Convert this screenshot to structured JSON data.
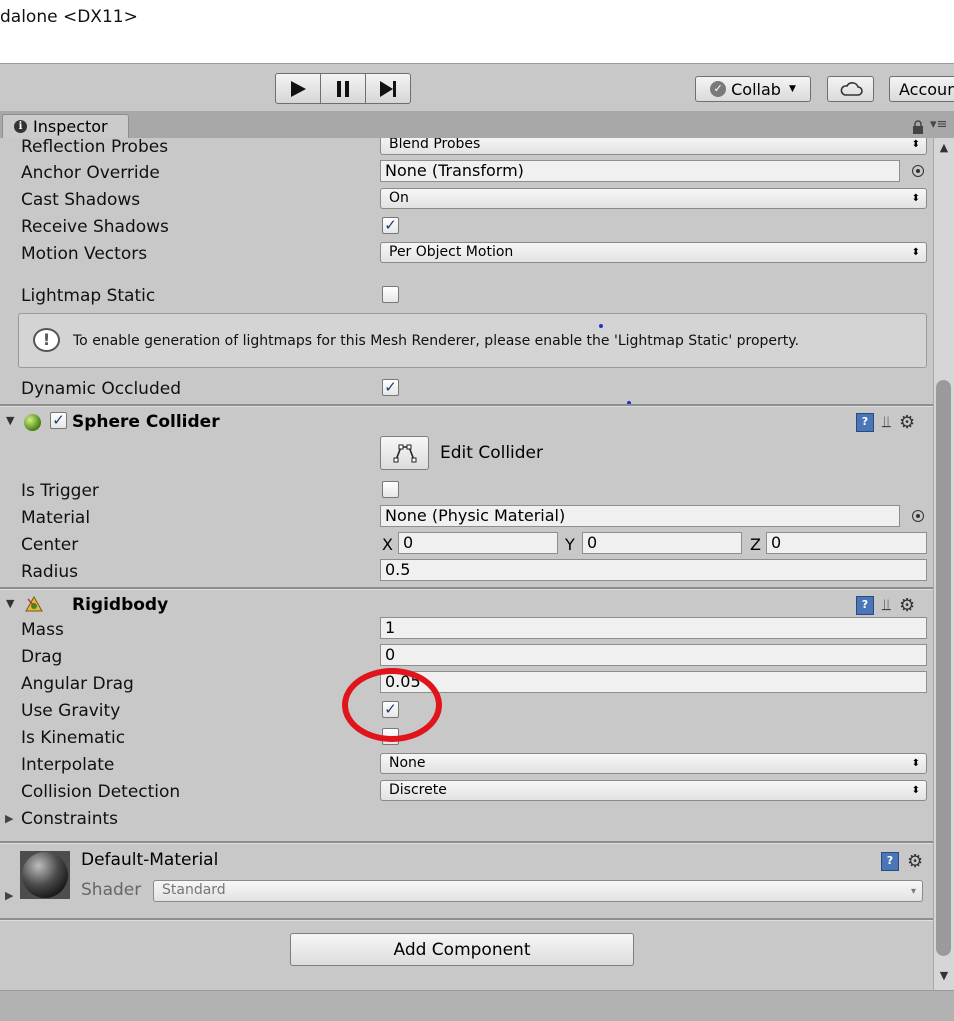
{
  "window": {
    "title": "dalone <DX11>"
  },
  "toolbar": {
    "collab_label": "Collab",
    "account_label": "Accoun"
  },
  "tabs": {
    "inspector_label": "Inspector"
  },
  "mesh_renderer": {
    "reflection_probes": {
      "label": "Reflection Probes",
      "value": "Blend Probes"
    },
    "anchor_override": {
      "label": "Anchor Override",
      "value": "None (Transform)"
    },
    "cast_shadows": {
      "label": "Cast Shadows",
      "value": "On"
    },
    "receive_shadows": {
      "label": "Receive Shadows",
      "checked": true
    },
    "motion_vectors": {
      "label": "Motion Vectors",
      "value": "Per Object Motion"
    },
    "lightmap_static": {
      "label": "Lightmap Static",
      "checked": false
    },
    "help_message": "To enable generation of lightmaps for this Mesh Renderer, please enable the 'Lightmap Static' property.",
    "dynamic_occluded": {
      "label": "Dynamic Occluded",
      "checked": true
    }
  },
  "sphere_collider": {
    "title": "Sphere Collider",
    "enabled": true,
    "edit_collider_label": "Edit Collider",
    "is_trigger": {
      "label": "Is Trigger",
      "checked": false
    },
    "material": {
      "label": "Material",
      "value": "None (Physic Material)"
    },
    "center": {
      "label": "Center",
      "x_label": "X",
      "x": "0",
      "y_label": "Y",
      "y": "0",
      "z_label": "Z",
      "z": "0"
    },
    "radius": {
      "label": "Radius",
      "value": "0.5"
    }
  },
  "rigidbody": {
    "title": "Rigidbody",
    "mass": {
      "label": "Mass",
      "value": "1"
    },
    "drag": {
      "label": "Drag",
      "value": "0"
    },
    "angular_drag": {
      "label": "Angular Drag",
      "value": "0.05"
    },
    "use_gravity": {
      "label": "Use Gravity",
      "checked": true
    },
    "is_kinematic": {
      "label": "Is Kinematic",
      "checked": false
    },
    "interpolate": {
      "label": "Interpolate",
      "value": "None"
    },
    "collision_detection": {
      "label": "Collision Detection",
      "value": "Discrete"
    },
    "constraints": {
      "label": "Constraints"
    }
  },
  "material": {
    "name": "Default-Material",
    "shader_label": "Shader",
    "shader_value": "Standard"
  },
  "add_component_label": "Add Component",
  "colors": {
    "annotation_circle": "#e0141a",
    "panel_bg": "#c8c8c8"
  }
}
